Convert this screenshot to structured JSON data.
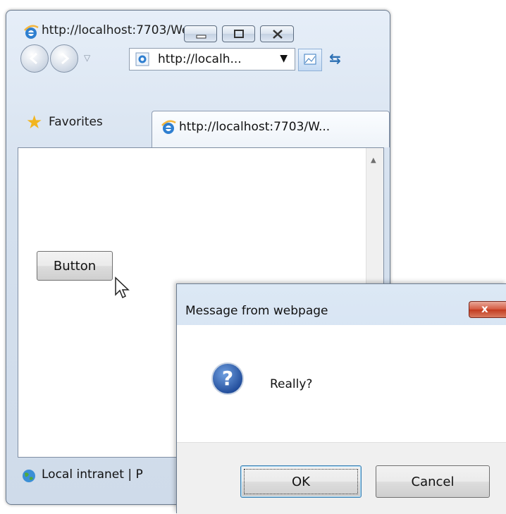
{
  "browser": {
    "window_title": "http://localhost:7703/We...",
    "address": "http://localh...",
    "favorites_label": "Favorites",
    "tab_title": "http://localhost:7703/W...",
    "status_text": "Local intranet | P"
  },
  "page": {
    "button_label": "Button"
  },
  "dialog": {
    "title": "Message from webpage",
    "message": "Really?",
    "ok_label": "OK",
    "cancel_label": "Cancel",
    "close_glyph": "x"
  },
  "icons": {
    "window": "ie-logo-icon",
    "address": "ie-page-icon",
    "favorites": "star-icon",
    "tab": "ie-logo-icon",
    "status": "globe-icon",
    "dialog": "question-icon"
  },
  "colors": {
    "dialog_close": "#c23a1f",
    "question_icon": "#2a5aa8",
    "favorites_star": "#f2b51f"
  }
}
